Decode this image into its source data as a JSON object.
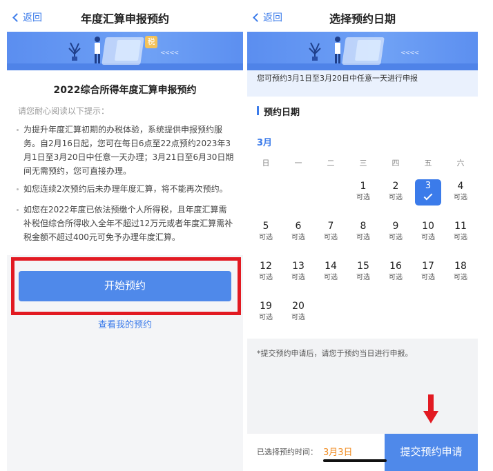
{
  "left": {
    "nav": {
      "back_label": "返回",
      "title": "年度汇算申报预约"
    },
    "banner": {
      "tax_sign": "税",
      "arrows": "<<<<"
    },
    "heading": "2022综合所得年度汇算申报预约",
    "hint": "请您耐心阅读以下提示：",
    "bullets": [
      "为提升年度汇算初期的办税体验，系统提供申报预约服务。自2月16日起，您可在每日6点至22点预约2023年3月1日至3月20日中任意一天办理；3月21日至6月30日期间无需预约，您可直接办理。",
      "如您连续2次预约后未办理年度汇算，将不能再次预约。",
      "如您在2022年度已依法预缴个人所得税，且年度汇算需补税但综合所得收入全年不超过12万元或者年度汇算需补税金额不超过400元可免予办理年度汇算。"
    ],
    "start_button": "开始预约",
    "my_reservations_link": "查看我的预约"
  },
  "right": {
    "nav": {
      "back_label": "返回",
      "title": "选择预约日期"
    },
    "banner": {
      "arrows": "<<<<"
    },
    "tip": "您可预约3月1日至3月20日中任意一天进行申报",
    "section_label": "预约日期",
    "month": "3月",
    "weekdays": [
      "日",
      "一",
      "二",
      "三",
      "四",
      "五",
      "六"
    ],
    "days": [
      {
        "num": "1",
        "status": "可选"
      },
      {
        "num": "2",
        "status": "可选"
      },
      {
        "num": "3",
        "status": "",
        "selected": true
      },
      {
        "num": "4",
        "status": "可选"
      },
      {
        "num": "5",
        "status": "可选"
      },
      {
        "num": "6",
        "status": "可选"
      },
      {
        "num": "7",
        "status": "可选"
      },
      {
        "num": "8",
        "status": "可选"
      },
      {
        "num": "9",
        "status": "可选"
      },
      {
        "num": "10",
        "status": "可选"
      },
      {
        "num": "11",
        "status": "可选"
      },
      {
        "num": "12",
        "status": "可选"
      },
      {
        "num": "13",
        "status": "可选"
      },
      {
        "num": "14",
        "status": "可选"
      },
      {
        "num": "15",
        "status": "可选"
      },
      {
        "num": "16",
        "status": "可选"
      },
      {
        "num": "17",
        "status": "可选"
      },
      {
        "num": "18",
        "status": "可选"
      },
      {
        "num": "19",
        "status": "可选"
      },
      {
        "num": "20",
        "status": "可选"
      }
    ],
    "note": "*提交预约申请后，请您于预约当日进行申报。",
    "selected_label": "已选择预约时间：",
    "selected_value": "3月3日",
    "submit_button": "提交预约申请"
  },
  "colors": {
    "accent": "#4f89ea",
    "highlight_red": "#e21a22",
    "selected_date": "#f08a1e"
  }
}
